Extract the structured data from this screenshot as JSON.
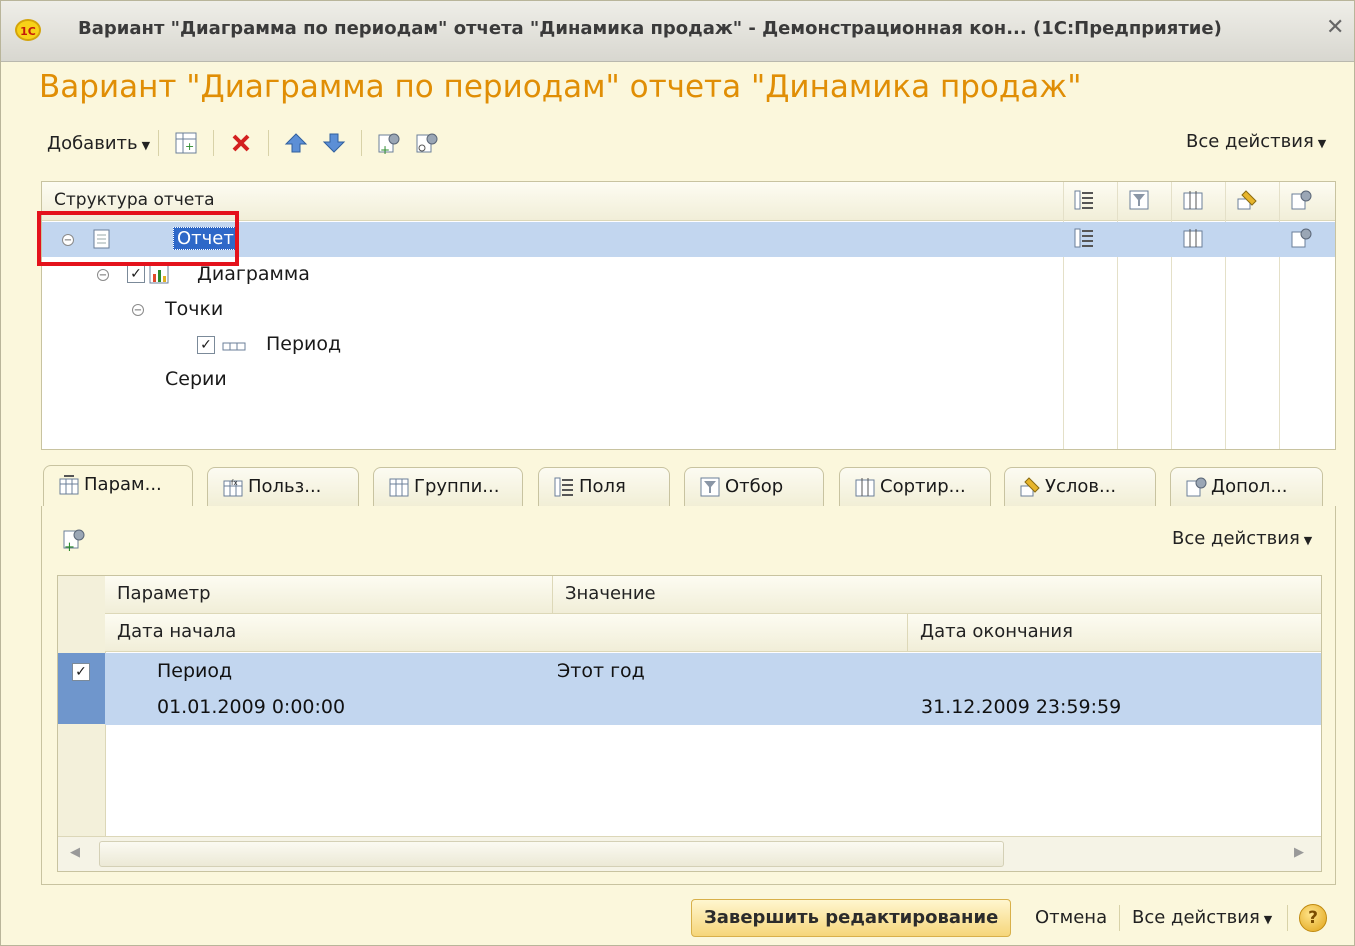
{
  "window": {
    "title": "Вариант \"Диаграмма по периодам\" отчета \"Динамика продаж\" - Демонстрационная кон...  (1С:Предприятие)",
    "app_logo": "1С",
    "close_glyph": "✕"
  },
  "page_title": "Вариант \"Диаграмма по периодам\" отчета \"Динамика продаж\"",
  "toolbar": {
    "add_label": "Добавить",
    "all_actions_label": "Все действия",
    "icons": [
      "add-grouping-icon",
      "delete-icon",
      "move-up-icon",
      "move-down-icon",
      "settings-icon",
      "settings-view-icon"
    ]
  },
  "structure": {
    "header": "Структура отчета",
    "header_icons": [
      "fields-icon",
      "filter-icon",
      "sort-icon",
      "conditional-format-icon",
      "extra-settings-icon"
    ],
    "rows": [
      {
        "label": "Отчет",
        "selected": true
      },
      {
        "label": "Диаграмма",
        "checked": true
      },
      {
        "label": "Точки"
      },
      {
        "label": "Период",
        "checked": true
      },
      {
        "label": "Серии"
      }
    ]
  },
  "tabs": [
    "Парам...",
    "Польз...",
    "Группи...",
    "Поля",
    "Отбор",
    "Сортир...",
    "Услов...",
    "Допол..."
  ],
  "active_tab": "Парам...",
  "params_panel": {
    "all_actions_label": "Все действия",
    "columns": {
      "param": "Параметр",
      "value": "Значение",
      "start": "Дата начала",
      "end": "Дата окончания"
    },
    "rows": [
      {
        "checked": true,
        "param": "Период",
        "value": "Этот год",
        "start": "01.01.2009 0:00:00",
        "end": "31.12.2009 23:59:59"
      }
    ]
  },
  "footer": {
    "finish_label": "Завершить редактирование",
    "cancel_label": "Отмена",
    "all_actions_label": "Все действия",
    "help_glyph": "?"
  },
  "colors": {
    "title_orange": "#e08e05",
    "selection_blue": "#c2d6ef",
    "highlight_red": "#e4121c",
    "window_bg": "#fbf7dc"
  }
}
